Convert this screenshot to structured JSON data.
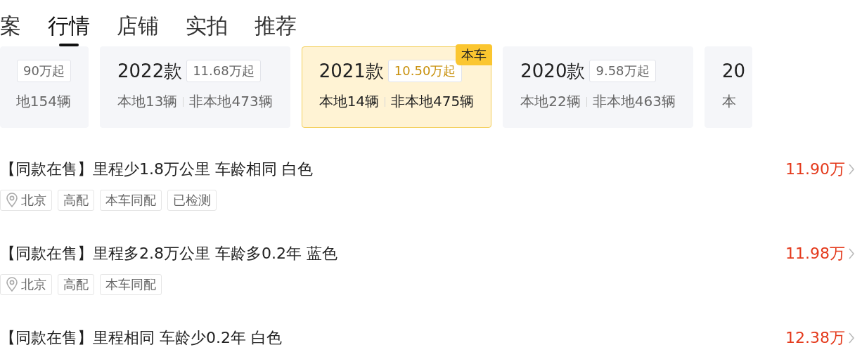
{
  "tabs": [
    {
      "label": "案",
      "selected": false
    },
    {
      "label": "行情",
      "selected": true
    },
    {
      "label": "店铺",
      "selected": false
    },
    {
      "label": "实拍",
      "selected": false
    },
    {
      "label": "推荐",
      "selected": false
    }
  ],
  "year_cards": [
    {
      "kind": "cut-left",
      "price": "90万起",
      "nonlocal": "地154辆",
      "selected": false
    },
    {
      "kind": "full",
      "year": "2022款",
      "price": "11.68万起",
      "local": "本地13辆",
      "nonlocal": "非本地473辆",
      "selected": false
    },
    {
      "kind": "full",
      "year": "2021款",
      "price": "10.50万起",
      "local": "本地14辆",
      "nonlocal": "非本地475辆",
      "selected": true,
      "badge": "本车"
    },
    {
      "kind": "full",
      "year": "2020款",
      "price": "9.58万起",
      "local": "本地22辆",
      "nonlocal": "非本地463辆",
      "selected": false
    },
    {
      "kind": "cut-right",
      "year": "20",
      "local": "本",
      "selected": false
    }
  ],
  "listings": [
    {
      "title": "【同款在售】里程少1.8万公里 车龄相同 白色",
      "price": "11.90万",
      "tags": [
        {
          "kind": "location",
          "text": "北京"
        },
        {
          "kind": "plain",
          "text": "高配"
        },
        {
          "kind": "plain",
          "text": "本车同配"
        },
        {
          "kind": "plain",
          "text": "已检测"
        }
      ]
    },
    {
      "title": "【同款在售】里程多2.8万公里 车龄多0.2年 蓝色",
      "price": "11.98万",
      "tags": [
        {
          "kind": "location",
          "text": "北京"
        },
        {
          "kind": "plain",
          "text": "高配"
        },
        {
          "kind": "plain",
          "text": "本车同配"
        }
      ]
    },
    {
      "title": "【同款在售】里程相同 车龄少0.2年 白色",
      "price": "12.38万"
    }
  ]
}
